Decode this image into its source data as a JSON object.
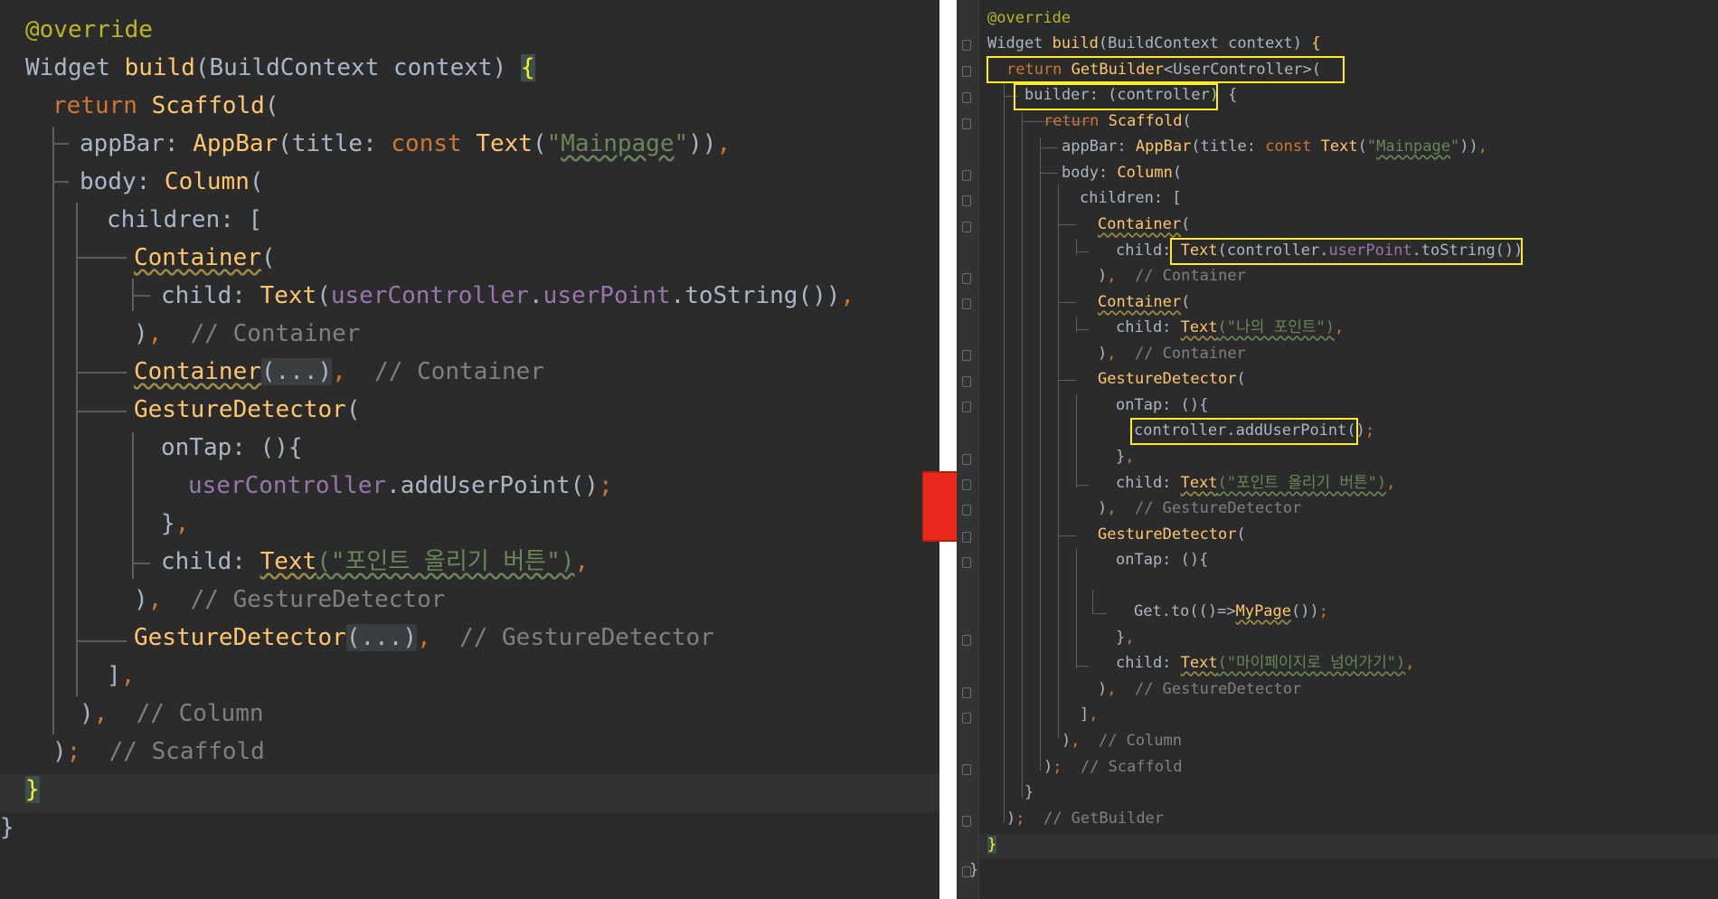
{
  "left": {
    "lines": [
      {
        "t": "@override",
        "c": "ann"
      },
      {
        "t": "Widget build(BuildContext context) {"
      },
      {
        "t": "return Scaffold("
      },
      {
        "t": "appBar: AppBar(title: const Text(\"Mainpage\")),"
      },
      {
        "t": "body: Column("
      },
      {
        "t": "children: ["
      },
      {
        "t": "Container("
      },
      {
        "t": "child: Text(userController.userPoint.toString()),"
      },
      {
        "t": "),  // Container"
      },
      {
        "t": "Container(...),  // Container"
      },
      {
        "t": "GestureDetector("
      },
      {
        "t": "onTap: (){"
      },
      {
        "t": "userController.addUserPoint();"
      },
      {
        "t": "},"
      },
      {
        "t": "child: Text(\"포인트 올리기 버튼\"),"
      },
      {
        "t": "),  // GestureDetector"
      },
      {
        "t": "GestureDetector(...),  // GestureDetector"
      },
      {
        "t": "],"
      },
      {
        "t": "),  // Column"
      },
      {
        "t": ");  // Scaffold"
      },
      {
        "t": "}"
      },
      {
        "t": "}"
      }
    ]
  },
  "right": {
    "lines": [
      {
        "t": "@override"
      },
      {
        "t": "Widget build(BuildContext context) {"
      },
      {
        "t": "return GetBuilder<UserController>("
      },
      {
        "t": "builder: (controller) {"
      },
      {
        "t": "return Scaffold("
      },
      {
        "t": "appBar: AppBar(title: const Text(\"Mainpage\")),"
      },
      {
        "t": "body: Column("
      },
      {
        "t": "children: ["
      },
      {
        "t": "Container("
      },
      {
        "t": "child: Text(controller.userPoint.toString())"
      },
      {
        "t": "),  // Container"
      },
      {
        "t": "Container("
      },
      {
        "t": "child: Text(\"나의 포인트\"),"
      },
      {
        "t": "),  // Container"
      },
      {
        "t": "GestureDetector("
      },
      {
        "t": "onTap: (){"
      },
      {
        "t": "controller.addUserPoint();"
      },
      {
        "t": "},"
      },
      {
        "t": "child: Text(\"포인트 올리기 버튼\"),"
      },
      {
        "t": "),  // GestureDetector"
      },
      {
        "t": "GestureDetector("
      },
      {
        "t": "onTap: (){"
      },
      {
        "t": ""
      },
      {
        "t": "Get.to(()=>MyPage());"
      },
      {
        "t": "},"
      },
      {
        "t": "child: Text(\"마이페이지로 넘어가기\"),"
      },
      {
        "t": "),  // GestureDetector"
      },
      {
        "t": "],"
      },
      {
        "t": "),  // Column"
      },
      {
        "t": ");  // Scaffold"
      },
      {
        "t": "}"
      },
      {
        "t": ");  // GetBuilder"
      },
      {
        "t": "}"
      },
      {
        "t": "}"
      }
    ]
  },
  "colors": {
    "editor_bg": "#2b2b2b",
    "keyword": "#cc7832",
    "function": "#ffc66d",
    "string": "#6a8759",
    "comment": "#808080",
    "field": "#9876aa",
    "annotation": "#bbb529",
    "highlight_box": "#ffeb2a",
    "arrow": "#e8291c"
  }
}
